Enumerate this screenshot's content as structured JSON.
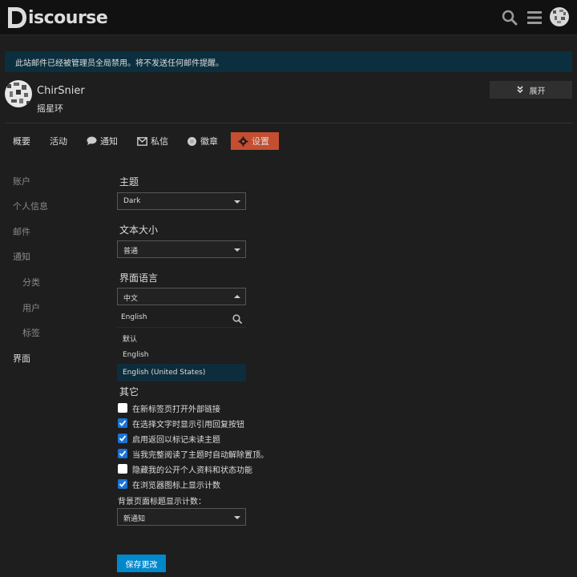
{
  "header": {
    "logo_text": "iscourse",
    "icons": [
      "search-icon",
      "hamburger-icon",
      "avatar"
    ]
  },
  "banner": {
    "text": "此站邮件已经被管理员全局禁用。将不发送任何邮件提醒。"
  },
  "user": {
    "username": "ChirSnier",
    "title": "摇星环",
    "expand_label": "展开"
  },
  "tabs": [
    {
      "label": "概要",
      "icon": ""
    },
    {
      "label": "活动",
      "icon": ""
    },
    {
      "label": "通知",
      "icon": "comment-icon"
    },
    {
      "label": "私信",
      "icon": "envelope-icon"
    },
    {
      "label": "徽章",
      "icon": "badge-icon"
    },
    {
      "label": "设置",
      "icon": "gear-icon",
      "active": true
    }
  ],
  "sidebar": {
    "items": [
      {
        "label": "账户"
      },
      {
        "label": "个人信息"
      },
      {
        "label": "邮件"
      },
      {
        "label": "通知"
      },
      {
        "label": "分类"
      },
      {
        "label": "用户"
      },
      {
        "label": "标签"
      },
      {
        "label": "界面",
        "active": true
      }
    ]
  },
  "theme": {
    "label": "主题",
    "value": "Dark"
  },
  "text_size": {
    "label": "文本大小",
    "value": "普通"
  },
  "interface_language": {
    "label": "界面语言",
    "value": "中文",
    "search_value": "English",
    "options": [
      "默认",
      "English",
      "English (United States)"
    ],
    "highlighted": "English (United States)"
  },
  "other": {
    "label": "其它",
    "checkboxes": [
      {
        "label": "在新标签页打开外部链接",
        "checked": false
      },
      {
        "label": "在选择文字时显示引用回复按钮",
        "checked": true
      },
      {
        "label": "启用返回以标记未读主题",
        "checked": true
      },
      {
        "label": "当我完整阅读了主题时自动解除置顶。",
        "checked": true
      },
      {
        "label": "隐藏我的公开个人资料和状态功能",
        "checked": false
      },
      {
        "label": "在浏览器图标上显示计数",
        "checked": true
      }
    ],
    "title_count_label": "背景页面标题显示计数：",
    "title_count_value": "新通知"
  },
  "save_label": "保存更改",
  "colors": {
    "header_bg": "#111111",
    "page_bg": "#1e1e1e",
    "banner_bg": "#0b2f3f",
    "active_tab": "#c54e30",
    "primary_button": "#0088cc",
    "checkbox_checked": "#1a73d6"
  }
}
